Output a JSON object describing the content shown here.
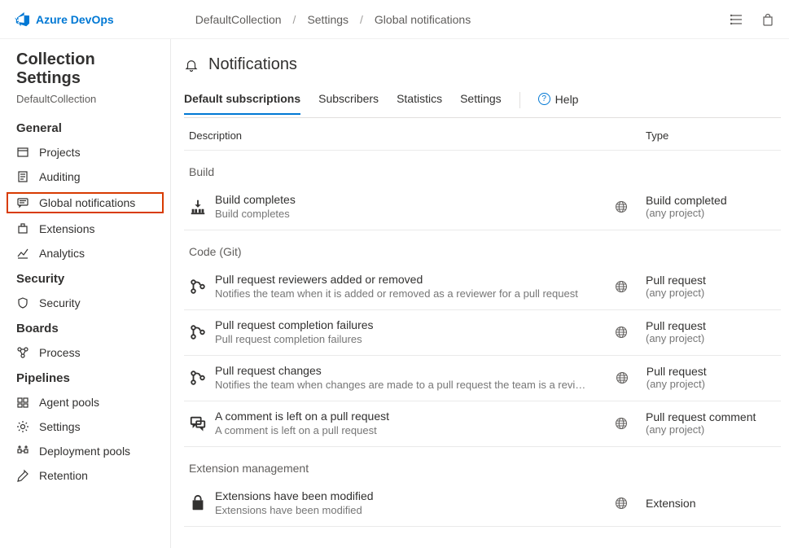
{
  "brand": "Azure DevOps",
  "breadcrumb": [
    "DefaultCollection",
    "Settings",
    "Global notifications"
  ],
  "sidebar": {
    "title": "Collection Settings",
    "subtitle": "DefaultCollection",
    "groups": [
      {
        "name": "General",
        "items": [
          {
            "label": "Projects",
            "icon": "projects"
          },
          {
            "label": "Auditing",
            "icon": "auditing"
          },
          {
            "label": "Global notifications",
            "icon": "notifications",
            "active": true
          },
          {
            "label": "Extensions",
            "icon": "extensions"
          },
          {
            "label": "Analytics",
            "icon": "analytics"
          }
        ]
      },
      {
        "name": "Security",
        "items": [
          {
            "label": "Security",
            "icon": "security"
          }
        ]
      },
      {
        "name": "Boards",
        "items": [
          {
            "label": "Process",
            "icon": "process"
          }
        ]
      },
      {
        "name": "Pipelines",
        "items": [
          {
            "label": "Agent pools",
            "icon": "agentpools"
          },
          {
            "label": "Settings",
            "icon": "gear"
          },
          {
            "label": "Deployment pools",
            "icon": "deploypools"
          },
          {
            "label": "Retention",
            "icon": "retention"
          }
        ]
      }
    ]
  },
  "page": {
    "title": "Notifications",
    "tabs": [
      "Default subscriptions",
      "Subscribers",
      "Statistics",
      "Settings"
    ],
    "activeTab": "Default subscriptions",
    "help": "Help",
    "colDesc": "Description",
    "colType": "Type"
  },
  "groups": [
    {
      "label": "Build",
      "icon": "build",
      "rows": [
        {
          "title": "Build completes",
          "sub": "Build completes",
          "type": "Build completed",
          "scope": "(any project)"
        }
      ]
    },
    {
      "label": "Code (Git)",
      "icon": "git",
      "rows": [
        {
          "title": "Pull request reviewers added or removed",
          "sub": "Notifies the team when it is added or removed as a reviewer for a pull request",
          "type": "Pull request",
          "scope": "(any project)"
        },
        {
          "title": "Pull request completion failures",
          "sub": "Pull request completion failures",
          "type": "Pull request",
          "scope": "(any project)"
        },
        {
          "title": "Pull request changes",
          "sub": "Notifies the team when changes are made to a pull request the team is a reviewer for",
          "type": "Pull request",
          "scope": "(any project)"
        },
        {
          "title": "A comment is left on a pull request",
          "sub": "A comment is left on a pull request",
          "type": "Pull request comment",
          "scope": "(any project)",
          "icon": "comment"
        }
      ]
    },
    {
      "label": "Extension management",
      "icon": "ext",
      "rows": [
        {
          "title": "Extensions have been modified",
          "sub": "Extensions have been modified",
          "type": "Extension",
          "scope": ""
        }
      ]
    }
  ]
}
